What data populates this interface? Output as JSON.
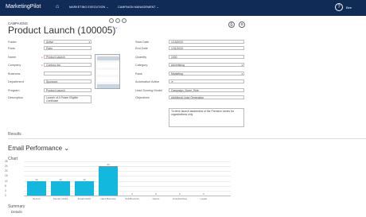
{
  "app": {
    "brand": "MarketingPilot",
    "nav": [
      "MARKETING EXECUTION ⌄",
      "CAMPAIGN MANAGEMENT ⌄"
    ],
    "user": "Bee"
  },
  "header": {
    "breadcrumb": "CAMPAIGNS",
    "title": "Product Launch (100005)"
  },
  "form_left": [
    {
      "label": "Folder",
      "required": false,
      "value": "Active",
      "dropdown": true
    },
    {
      "label": "Parts",
      "required": false,
      "value": "Parts",
      "dropdown": false
    },
    {
      "label": "Name",
      "required": true,
      "value": "Product Launch",
      "dropdown": false
    },
    {
      "label": "Company",
      "required": true,
      "value": "Contoso Inc.",
      "dropdown": false
    },
    {
      "label": "Business",
      "required": false,
      "value": "",
      "dropdown": false
    },
    {
      "label": "Department",
      "required": false,
      "value": "Sponsors",
      "dropdown": false
    },
    {
      "label": "Program",
      "required": false,
      "value": "Product Launch",
      "dropdown": false
    },
    {
      "label": "Description",
      "required": false,
      "value": "Launch of A Power Eligible Certificate",
      "dropdown": false
    }
  ],
  "form_right": [
    {
      "label": "Start Date",
      "required": true,
      "value": "1/15/2020",
      "dropdown": false
    },
    {
      "label": "End Date",
      "required": true,
      "value": "1/31/2020",
      "dropdown": false
    },
    {
      "label": "Quantity",
      "required": false,
      "value": "1000",
      "dropdown": false
    },
    {
      "label": "Category",
      "required": false,
      "value": "Advertising",
      "dropdown": true
    },
    {
      "label": "Rank",
      "required": false,
      "value": "Marketing",
      "dropdown": true
    },
    {
      "label": "Automation Active",
      "required": false,
      "value": "✕",
      "dropdown": false
    },
    {
      "label": "Lead Scoring Model",
      "required": false,
      "value": "Campaign_Score_Rule",
      "dropdown": false
    },
    {
      "label": "Objectives",
      "required": false,
      "value": "Additional Lead Generation",
      "dropdown": false
    }
  ],
  "objectives_text": "To drive launch awareness of the Premium series for organizations only",
  "sections": {
    "results": "Results",
    "email_perf": "Email Performance ⌄",
    "chart": "Chart",
    "summary": "Summary",
    "details": "Details"
  },
  "chart_data": {
    "type": "bar",
    "categories": [
      "Sent-to",
      "Sender Clicks",
      "Email Clicks",
      "Hard Bounces",
      "Soft Bounces",
      "Opens",
      "Unsubscribes",
      "Leads"
    ],
    "values": [
      12,
      12,
      12,
      24,
      0,
      0,
      0,
      0
    ],
    "ylim": [
      0,
      28
    ],
    "yticks": [
      "28",
      "24",
      "20",
      "16",
      "12",
      "8",
      "4",
      "0"
    ],
    "grid": true
  },
  "icons": {
    "home": "home-icon",
    "help": "help-icon",
    "print": "print-icon",
    "gear": "gear-icon"
  }
}
